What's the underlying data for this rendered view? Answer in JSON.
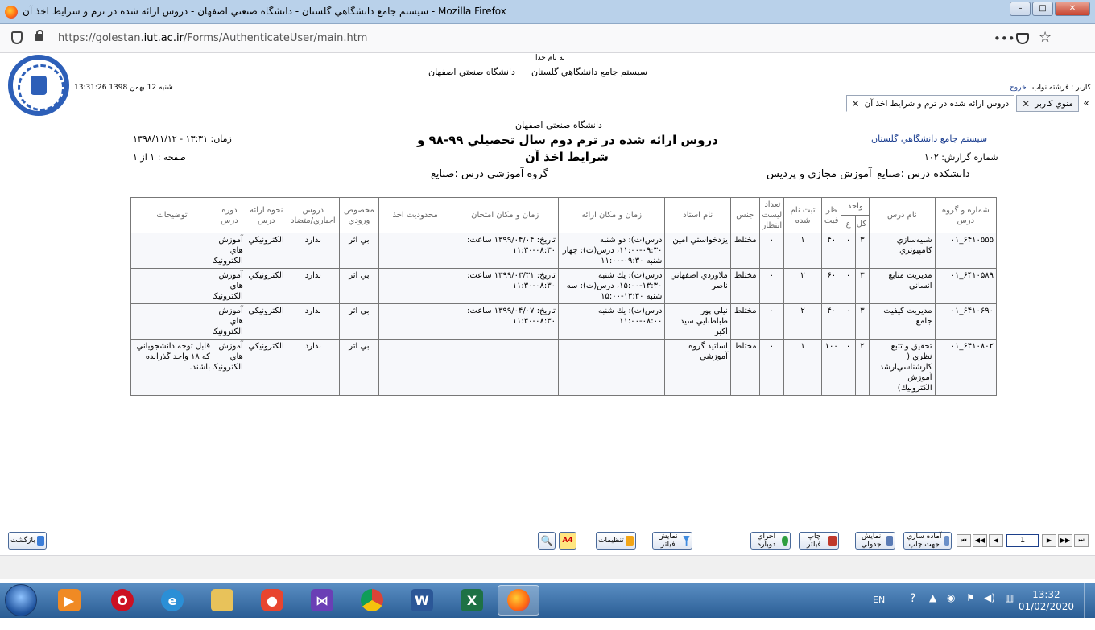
{
  "window": {
    "title": "سيستم جامع دانشگاهي گلستان - دانشگاه صنعتي اصفهان - دروس ارائه شده در ترم و شرايط اخذ آن - Mozilla Firefox",
    "buttons": [
      "–",
      "□",
      "✕"
    ]
  },
  "browser": {
    "url_prefix": "https://golestan.",
    "url_domain": "iut.ac.ir",
    "url_path": "/Forms/AuthenticateUser/main.htm",
    "icons": [
      "shield-icon",
      "lock-icon",
      "more-icon",
      "pocket-icon",
      "star-icon"
    ]
  },
  "header": {
    "basmala": "به نام خدا",
    "system_name": "سيستم جامع دانشگاهي گلستان",
    "university": "دانشگاه صنعتي اصفهان",
    "datetime": "13:31:26 شنبه 12 بهمن 1398",
    "user_label": "كاربر : فرشته نواب",
    "logout": "خروج"
  },
  "tabs": [
    {
      "label": "دروس ارائه شده در ترم و شرايط اخذ آن",
      "active": true
    },
    {
      "label": "منوي كاربر",
      "active": false
    }
  ],
  "report": {
    "university": "دانشگاه صنعتي اصفهان",
    "title_line1": "دروس ارائه شده در ترم دوم سال تحصيلي ۹۹-۹۸ و",
    "title_line2": "شرايط اخذ آن",
    "system": "سيستم جامع دانشگاهي گلستان",
    "report_no": "شماره گزارش: ۱۰۲",
    "time": "زمان:  ۱۳:۳۱ - ۱۳۹۸/۱۱/۱۲",
    "page": "صفحه : ۱ از ۱",
    "faculty": "دانشكده درس :صنايع_آموزش مجازي و پرديس",
    "group": "گروه آموزشي درس :صنايع"
  },
  "table": {
    "headers": {
      "code": "شماره و گروه درس",
      "name": "نام درس",
      "units": "واحد",
      "total": "كل",
      "practical": "ع",
      "capacity": "ظر فيت",
      "registered": "ثبت نام شده",
      "waitlist": "تعداد ليست انتظار",
      "gender": "جنس",
      "teacher": "نام استاد",
      "schedule": "زمان و مكان ارائه",
      "exam": "زمان و مكان امتحان",
      "restriction": "محدوديت اخذ",
      "entry": "مخصوص ورودي",
      "prereq": "دروس اجباري/متضاد",
      "method": "نحوه ارائه درس",
      "period": "دوره درس",
      "notes": "توضيحات"
    },
    "rows": [
      {
        "code": "۶۴۱۰۵۵۵_۰۱",
        "name": "شبيه‌سازي كامپيوتري",
        "total": "۳",
        "practical": "۰",
        "capacity": "۴۰",
        "registered": "۱",
        "waitlist": "۰",
        "gender": "مختلط",
        "teacher": "يزدخواستي امين",
        "schedule": "درس(ت): دو شنبه ۰۹:۳۰-۱۱:۰۰، درس(ت): چهار شنبه ۰۹:۳۰-۱۱:۰۰",
        "exam": "تاريخ: ۱۳۹۹/۰۴/۰۴ ساعت: ۰۸:۳۰-۱۱:۳۰",
        "restriction": "",
        "entry": "بي اثر",
        "prereq": "ندارد",
        "method": "الكترونيكي",
        "period": "آموزش هاي الكترونيكي",
        "notes": ""
      },
      {
        "code": "۶۴۱۰۵۸۹_۰۱",
        "name": "مديريت منابع انساني",
        "total": "۳",
        "practical": "۰",
        "capacity": "۶۰",
        "registered": "۲",
        "waitlist": "۰",
        "gender": "مختلط",
        "teacher": "ملاوردي اصفهاني ناصر",
        "schedule": "درس(ت): يك شنبه ۱۳:۳۰-۱۵:۰۰، درس(ت): سه شنبه ۱۳:۳۰-۱۵:۰۰",
        "exam": "تاريخ: ۱۳۹۹/۰۳/۳۱ ساعت: ۰۸:۳۰-۱۱:۳۰",
        "restriction": "",
        "entry": "بي اثر",
        "prereq": "ندارد",
        "method": "الكترونيكي",
        "period": "آموزش هاي الكترونيكي",
        "notes": ""
      },
      {
        "code": "۶۴۱۰۶۹۰_۰۱",
        "name": "مديريت كيفيت جامع",
        "total": "۳",
        "practical": "۰",
        "capacity": "۴۰",
        "registered": "۲",
        "waitlist": "۰",
        "gender": "مختلط",
        "teacher": "نيلي پور طباطبايي سيد اكبر",
        "schedule": "درس(ت): يك شنبه ۰۸:۰۰-۱۱:۰۰",
        "exam": "تاريخ: ۱۳۹۹/۰۴/۰۷ ساعت: ۰۸:۳۰-۱۱:۳۰",
        "restriction": "",
        "entry": "بي اثر",
        "prereq": "ندارد",
        "method": "الكترونيكي",
        "period": "آموزش هاي الكترونيكي",
        "notes": ""
      },
      {
        "code": "۶۴۱۰۸۰۲_۰۱",
        "name": "تحقيق و تتبع نظري ( كارشناسي‌ارشد آموزش الكترونيك)",
        "total": "۲",
        "practical": "۰",
        "capacity": "۱۰۰",
        "registered": "۱",
        "waitlist": "۰",
        "gender": "مختلط",
        "teacher": "اساتيد گروه آموزشي",
        "schedule": "",
        "exam": "",
        "restriction": "",
        "entry": "بي اثر",
        "prereq": "ندارد",
        "method": "الكترونيكي",
        "period": "آموزش هاي الكترونيكي",
        "notes": "قابل توجه دانشجوياني كه ۱۸ واحد گذرانده باشند."
      }
    ]
  },
  "toolbar": {
    "back": "بازگشت",
    "settings": "تنظيمات",
    "filter_show": "نمايش فيلتر",
    "rerun": "اجراي دوباره",
    "print_filter": "چاپ فيلتر",
    "table_view": "نمايش جدولي",
    "print_prep": "آماده سازي جهت چاپ",
    "page_value": "1",
    "a4": "A4"
  },
  "taskbar": {
    "lang": "EN",
    "time": "13:32",
    "date": "01/02/2020"
  }
}
